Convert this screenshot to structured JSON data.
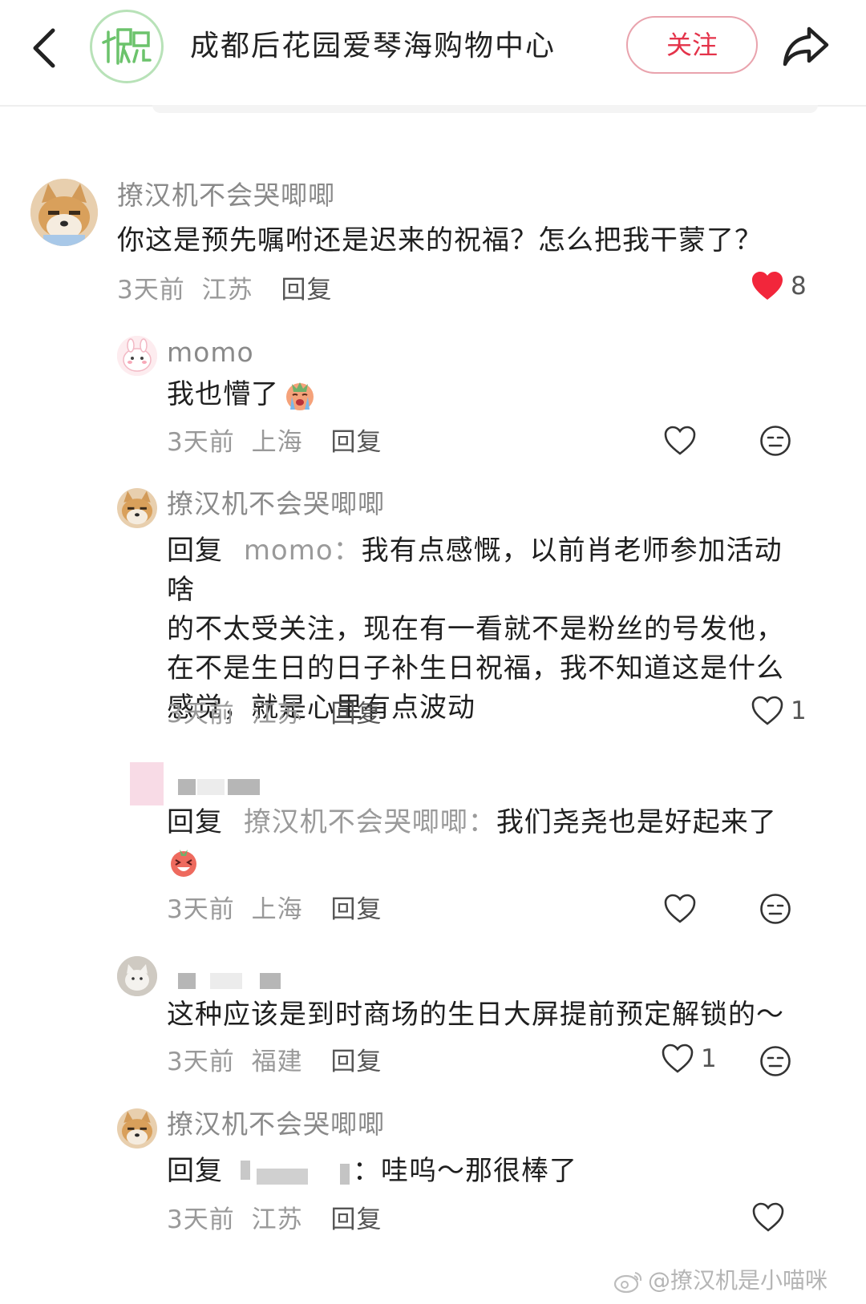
{
  "header": {
    "title": "成都后花园爱琴海购物中心",
    "follow_label": "关注",
    "accent_color": "#e4334a"
  },
  "comments": [
    {
      "user": "撩汉机不会哭唧唧",
      "text": "你这是预先嘱咐还是迟来的祝福？怎么把我干蒙了？",
      "time": "3天前",
      "location": "江苏",
      "reply_label": "回复",
      "likes": "8",
      "liked": true
    },
    {
      "user": "momo",
      "text": "我也懵了",
      "time": "3天前",
      "location": "上海",
      "reply_label": "回复"
    },
    {
      "user": "撩汉机不会哭唧唧",
      "reply_prefix": "回复",
      "mention": "momo：",
      "lines": [
        "我有点感慨，以前肖老师参加活动啥",
        "的不太受关注，现在有一看就不是粉丝的号发他，",
        "在不是生日的日子补生日祝福，我不知道这是什么",
        "感觉，就是心里有点波动"
      ],
      "time": "3天前",
      "location": "江苏",
      "reply_label": "回复",
      "likes": "1"
    },
    {
      "reply_prefix": "回复",
      "mention": "撩汉机不会哭唧唧：",
      "text": "我们尧尧也是好起来了",
      "time": "3天前",
      "location": "上海",
      "reply_label": "回复"
    },
    {
      "text": "这种应该是到时商场的生日大屏提前预定解锁的～",
      "time": "3天前",
      "location": "福建",
      "reply_label": "回复",
      "likes": "1"
    },
    {
      "user": "撩汉机不会哭唧唧",
      "reply_prefix": "回复",
      "mention_suffix": "：",
      "text": "哇呜～那很棒了",
      "time": "3天前",
      "location": "江苏",
      "reply_label": "回复"
    }
  ],
  "watermark": "@撩汉机是小喵咪",
  "icons": [
    "back-arrow-icon",
    "share-icon",
    "heart-icon",
    "emoji-icon",
    "weibo-icon"
  ]
}
